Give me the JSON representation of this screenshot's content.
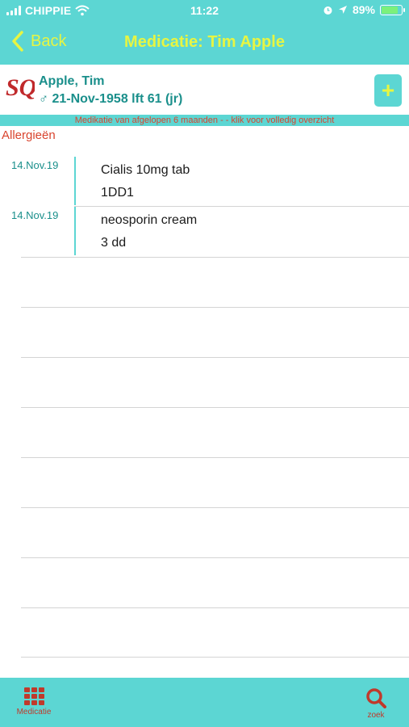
{
  "status_bar": {
    "carrier": "CHIPPIE",
    "time": "11:22",
    "battery": "89%",
    "battery_level": 0.89
  },
  "nav": {
    "back_label": "Back",
    "title": "Medicatie: Tim Apple"
  },
  "patient": {
    "logo_text": "SQ",
    "name": "Apple, Tim",
    "birth_line": "♂ 21-Nov-1958 lft 61 (jr)",
    "add_label": "+"
  },
  "history_link": "Medikatie van afgelopen 6 maanden - - klik voor volledig overzicht",
  "allergies_label": "Allergieën",
  "medications": [
    {
      "date": "14.Nov.19",
      "name": "Cialis 10mg tab",
      "dose": "1DD1"
    },
    {
      "date": "14.Nov.19",
      "name": "neosporin  cream",
      "dose": "3 dd"
    }
  ],
  "tabs": {
    "left_label": "Medicatie",
    "right_label": "zoek"
  },
  "colors": {
    "accent": "#5cd6d3",
    "title": "#e7f542",
    "patient_text": "#1a8f8b",
    "alert": "#d9442e"
  }
}
